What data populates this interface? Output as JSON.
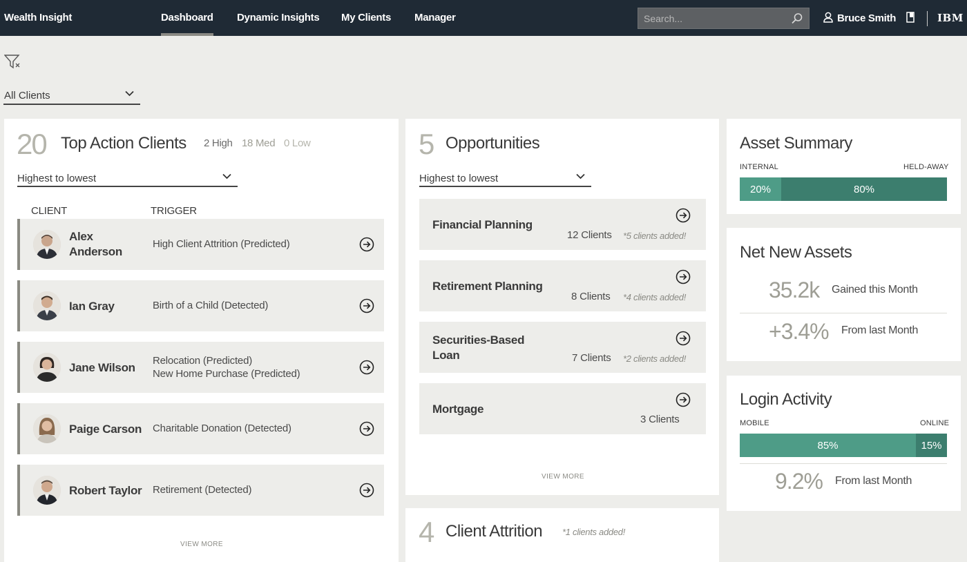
{
  "app": {
    "brand": "Wealth Insight"
  },
  "nav": {
    "items": [
      "Dashboard",
      "Dynamic Insights",
      "My Clients",
      "Manager"
    ],
    "active": "Dashboard"
  },
  "search": {
    "placeholder": "Search..."
  },
  "user": {
    "name": "Bruce Smith"
  },
  "vendor": {
    "logo": "IBM"
  },
  "filter": {
    "selected": "All Clients"
  },
  "top_action": {
    "count": "20",
    "title": "Top Action Clients",
    "high": "2 High",
    "med": "18 Med",
    "low": "0 Low",
    "sort": "Highest to lowest",
    "col_client": "CLIENT",
    "col_trigger": "TRIGGER",
    "rows": [
      {
        "name_line1": "Alex",
        "name_line2": "Anderson",
        "trigger1": "High Client Attrition (Predicted)",
        "trigger2": ""
      },
      {
        "name_line1": "Ian Gray",
        "name_line2": "",
        "trigger1": "Birth of a Child (Detected)",
        "trigger2": ""
      },
      {
        "name_line1": "Jane Wilson",
        "name_line2": "",
        "trigger1": "Relocation (Predicted)",
        "trigger2": "New Home Purchase (Predicted)"
      },
      {
        "name_line1": "Paige Carson",
        "name_line2": "",
        "trigger1": "Charitable Donation (Detected)",
        "trigger2": ""
      },
      {
        "name_line1": "Robert Taylor",
        "name_line2": "",
        "trigger1": "Retirement (Detected)",
        "trigger2": ""
      }
    ],
    "view_more": "VIEW MORE"
  },
  "opportunities": {
    "count": "5",
    "title": "Opportunities",
    "sort": "Highest to lowest",
    "rows": [
      {
        "title_line1": "Financial Planning",
        "title_line2": "",
        "clients": "12 Clients",
        "added": "*5 clients added!"
      },
      {
        "title_line1": "Retirement Planning",
        "title_line2": "",
        "clients": "8 Clients",
        "added": "*4 clients added!"
      },
      {
        "title_line1": "Securities-Based",
        "title_line2": "Loan",
        "clients": "7 Clients",
        "added": "*2 clients added!"
      },
      {
        "title_line1": "Mortgage",
        "title_line2": "",
        "clients": "3 Clients",
        "added": ""
      }
    ],
    "view_more": "VIEW MORE"
  },
  "attrition": {
    "count": "4",
    "title": "Client Attrition",
    "added": "*1 clients added!"
  },
  "asset_summary": {
    "title": "Asset Summary",
    "left_label": "INTERNAL",
    "right_label": "HELD-AWAY",
    "left_value": "20%",
    "right_value": "80%",
    "left_fraction": 0.2
  },
  "net_new_assets": {
    "title": "Net New Assets",
    "stat1_value": "35.2k",
    "stat1_label": "Gained this Month",
    "stat2_value": "+3.4%",
    "stat2_label": "From last Month"
  },
  "login_activity": {
    "title": "Login Activity",
    "left_label": "MOBILE",
    "right_label": "ONLINE",
    "left_value": "85%",
    "right_value": "15%",
    "left_fraction": 0.85,
    "stat_value": "9.2%",
    "stat_label": "From last Month"
  },
  "colors": {
    "topbar": "#1f2a35",
    "bar_primary": "#4e9c87",
    "bar_secondary": "#3c7e6e",
    "page_bg": "#ededea"
  }
}
